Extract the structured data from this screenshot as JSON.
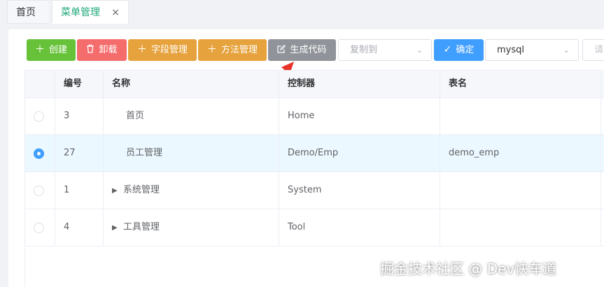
{
  "tabs": [
    {
      "label": "首页"
    },
    {
      "label": "菜单管理",
      "close": "×"
    }
  ],
  "toolbar": {
    "create_label": "创建",
    "uninstall_label": "卸载",
    "field_label": "字段管理",
    "method_label": "方法管理",
    "generate_label": "生成代码",
    "copy_placeholder": "复制到",
    "confirm_label": "确定",
    "db_value": "mysql",
    "search_placeholder": "请"
  },
  "table": {
    "headers": [
      "编号",
      "名称",
      "控制器",
      "表名"
    ],
    "rows": [
      {
        "id": "3",
        "name": "首页",
        "controller": "Home",
        "table": "",
        "selected": false,
        "expandable": false
      },
      {
        "id": "27",
        "name": "员工管理",
        "controller": "Demo/Emp",
        "table": "demo_emp",
        "selected": true,
        "expandable": false
      },
      {
        "id": "1",
        "name": "系统管理",
        "controller": "System",
        "table": "",
        "selected": false,
        "expandable": true
      },
      {
        "id": "4",
        "name": "工具管理",
        "controller": "Tool",
        "table": "",
        "selected": false,
        "expandable": true
      }
    ]
  },
  "watermark": "掘金技术社区 @ Dev快车道",
  "colors": {
    "accent": "#1fa87a",
    "success": "#67c23a",
    "danger": "#f56c6c",
    "warning": "#e6a23c",
    "info": "#909399",
    "primary": "#409eff",
    "annotation": "#e8332a"
  }
}
